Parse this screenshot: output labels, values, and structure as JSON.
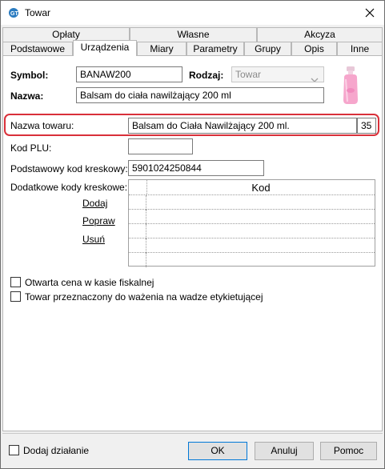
{
  "window": {
    "title": "Towar"
  },
  "tabs_row1": [
    {
      "label": "Opłaty"
    },
    {
      "label": "Własne"
    },
    {
      "label": "Akcyza"
    }
  ],
  "tabs_row2": [
    {
      "label": "Podstawowe"
    },
    {
      "label": "Urządzenia"
    },
    {
      "label": "Miary"
    },
    {
      "label": "Parametry"
    },
    {
      "label": "Grupy"
    },
    {
      "label": "Opis"
    },
    {
      "label": "Inne"
    }
  ],
  "active_tab": "Urządzenia",
  "form": {
    "symbol_label": "Symbol:",
    "symbol_value": "BANAW200",
    "rodzaj_label": "Rodzaj:",
    "rodzaj_value": "Towar",
    "nazwa_label": "Nazwa:",
    "nazwa_value": "Balsam do ciała nawilżający 200 ml",
    "product_image_icon": "lotion-bottle-icon"
  },
  "device": {
    "nazwa_towaru_label": "Nazwa towaru:",
    "nazwa_towaru_value": "Balsam do Ciała Nawilżający 200 ml.",
    "nazwa_towaru_count": "35",
    "kod_plu_label": "Kod PLU:",
    "kod_plu_value": "",
    "barcode_label": "Podstawowy kod kreskowy:",
    "barcode_value": "5901024250844",
    "extra_codes_label": "Dodatkowe kody kreskowe:",
    "add_link": "Dodaj",
    "edit_link": "Popraw",
    "delete_link": "Usuń",
    "grid_header": "Kod",
    "checkbox_open_price": "Otwarta cena w kasie fiskalnej",
    "checkbox_weighing": "Towar przeznaczony do ważenia na wadze etykietującej"
  },
  "footer": {
    "add_action_label": "Dodaj działanie",
    "ok_label": "OK",
    "cancel_label": "Anuluj",
    "help_label": "Pomoc"
  },
  "colors": {
    "highlight": "#d9303a",
    "dialog_bg": "#f0f0f0"
  }
}
